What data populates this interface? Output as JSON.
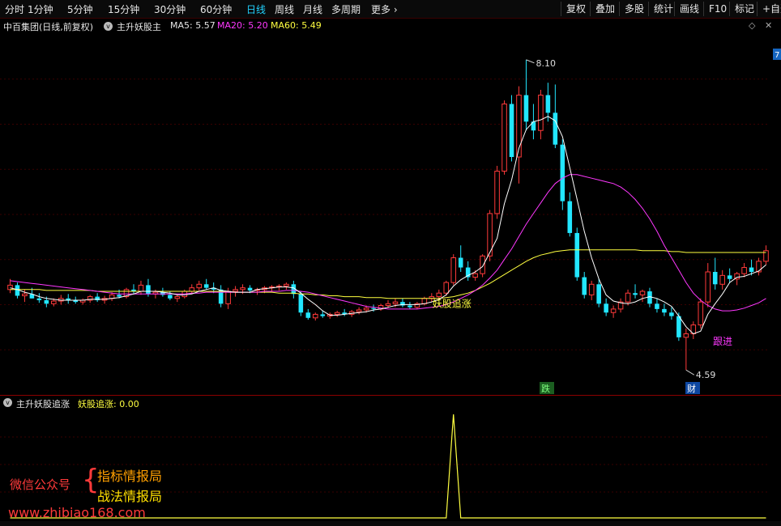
{
  "toolbar": {
    "periods": [
      "分时",
      "1分钟",
      "5分钟",
      "15分钟",
      "30分钟",
      "60分钟",
      "日线",
      "周线",
      "月线",
      "多周期",
      "更多"
    ],
    "active_period": "日线",
    "buttons": [
      "复权",
      "叠加",
      "多股",
      "统计",
      "画线",
      "F10",
      "标记",
      "+自选"
    ]
  },
  "info": {
    "stock": "中百集团(日线,前复权)",
    "indicator": "主升妖股主",
    "ma5": "MA5: 5.57",
    "ma20": "MA20: 5.20",
    "ma60": "MA60: 5.49"
  },
  "chart": {
    "price_high_label": "8.10",
    "price_low_label": "4.59",
    "signal_label": "妖股追涨",
    "marker_fall": "跌",
    "marker_cai": "财",
    "marker_follow": "跟进",
    "right_edge_label": "7"
  },
  "sub": {
    "indicator": "主升妖股追涨",
    "value": "妖股追涨: 0.00"
  },
  "watermark": {
    "wechat": "微信公众号",
    "line1": "指标情报局",
    "line2": "战法情报局",
    "url": "www.zhibiao168.com"
  },
  "colors": {
    "up": "#ff3a3a",
    "down": "#22e6ff",
    "ma5": "#ffffff",
    "ma20": "#ff38ff",
    "ma60": "#ffff40",
    "active_tab": "#22d3ff"
  },
  "chart_data": {
    "type": "candlestick",
    "ohlc": [
      [
        5.5,
        5.62,
        5.46,
        5.55
      ],
      [
        5.55,
        5.58,
        5.4,
        5.43
      ],
      [
        5.43,
        5.5,
        5.36,
        5.45
      ],
      [
        5.45,
        5.52,
        5.4,
        5.4
      ],
      [
        5.4,
        5.46,
        5.35,
        5.38
      ],
      [
        5.38,
        5.42,
        5.3,
        5.34
      ],
      [
        5.34,
        5.4,
        5.31,
        5.37
      ],
      [
        5.37,
        5.44,
        5.33,
        5.4
      ],
      [
        5.4,
        5.45,
        5.34,
        5.38
      ],
      [
        5.38,
        5.42,
        5.34,
        5.36
      ],
      [
        5.36,
        5.4,
        5.33,
        5.38
      ],
      [
        5.38,
        5.44,
        5.35,
        5.42
      ],
      [
        5.42,
        5.46,
        5.36,
        5.38
      ],
      [
        5.38,
        5.43,
        5.34,
        5.4
      ],
      [
        5.4,
        5.47,
        5.37,
        5.44
      ],
      [
        5.44,
        5.5,
        5.4,
        5.42
      ],
      [
        5.42,
        5.52,
        5.4,
        5.5
      ],
      [
        5.5,
        5.56,
        5.45,
        5.48
      ],
      [
        5.48,
        5.6,
        5.44,
        5.55
      ],
      [
        5.55,
        5.62,
        5.42,
        5.45
      ],
      [
        5.45,
        5.5,
        5.4,
        5.47
      ],
      [
        5.47,
        5.52,
        5.42,
        5.44
      ],
      [
        5.44,
        5.48,
        5.38,
        5.4
      ],
      [
        5.4,
        5.44,
        5.36,
        5.42
      ],
      [
        5.42,
        5.5,
        5.4,
        5.48
      ],
      [
        5.48,
        5.56,
        5.45,
        5.52
      ],
      [
        5.52,
        5.6,
        5.48,
        5.56
      ],
      [
        5.56,
        5.62,
        5.5,
        5.52
      ],
      [
        5.52,
        5.58,
        5.46,
        5.5
      ],
      [
        5.5,
        5.55,
        5.3,
        5.34
      ],
      [
        5.34,
        5.52,
        5.28,
        5.48
      ],
      [
        5.48,
        5.54,
        5.42,
        5.5
      ],
      [
        5.5,
        5.56,
        5.45,
        5.52
      ],
      [
        5.52,
        5.55,
        5.46,
        5.49
      ],
      [
        5.49,
        5.52,
        5.44,
        5.5
      ],
      [
        5.5,
        5.54,
        5.46,
        5.52
      ],
      [
        5.52,
        5.55,
        5.48,
        5.53
      ],
      [
        5.53,
        5.56,
        5.49,
        5.54
      ],
      [
        5.54,
        5.58,
        5.5,
        5.56
      ],
      [
        5.56,
        5.6,
        5.4,
        5.45
      ],
      [
        5.45,
        5.48,
        5.2,
        5.24
      ],
      [
        5.24,
        5.28,
        5.16,
        5.18
      ],
      [
        5.18,
        5.24,
        5.15,
        5.22
      ],
      [
        5.22,
        5.26,
        5.18,
        5.2
      ],
      [
        5.2,
        5.24,
        5.17,
        5.22
      ],
      [
        5.22,
        5.26,
        5.19,
        5.24
      ],
      [
        5.24,
        5.28,
        5.2,
        5.22
      ],
      [
        5.22,
        5.27,
        5.19,
        5.25
      ],
      [
        5.25,
        5.3,
        5.22,
        5.27
      ],
      [
        5.27,
        5.32,
        5.24,
        5.29
      ],
      [
        5.29,
        5.33,
        5.25,
        5.28
      ],
      [
        5.28,
        5.34,
        5.26,
        5.32
      ],
      [
        5.32,
        5.38,
        5.29,
        5.34
      ],
      [
        5.34,
        5.4,
        5.3,
        5.36
      ],
      [
        5.36,
        5.4,
        5.3,
        5.32
      ],
      [
        5.32,
        5.36,
        5.28,
        5.3
      ],
      [
        5.3,
        5.36,
        5.28,
        5.34
      ],
      [
        5.34,
        5.42,
        5.32,
        5.4
      ],
      [
        5.4,
        5.46,
        5.36,
        5.42
      ],
      [
        5.42,
        5.5,
        5.38,
        5.46
      ],
      [
        5.46,
        5.6,
        5.43,
        5.58
      ],
      [
        5.58,
        5.9,
        5.55,
        5.86
      ],
      [
        5.86,
        6.0,
        5.7,
        5.75
      ],
      [
        5.75,
        5.82,
        5.6,
        5.64
      ],
      [
        5.64,
        5.72,
        5.6,
        5.68
      ],
      [
        5.68,
        5.9,
        5.64,
        5.88
      ],
      [
        5.88,
        6.4,
        5.82,
        6.36
      ],
      [
        6.36,
        6.9,
        6.3,
        6.84
      ],
      [
        6.84,
        7.64,
        6.8,
        7.6
      ],
      [
        7.6,
        7.7,
        6.95,
        7.0
      ],
      [
        7.0,
        7.8,
        6.7,
        7.7
      ],
      [
        7.7,
        8.1,
        7.3,
        7.4
      ],
      [
        7.4,
        7.6,
        7.2,
        7.3
      ],
      [
        7.3,
        7.76,
        7.2,
        7.7
      ],
      [
        7.7,
        7.84,
        7.4,
        7.5
      ],
      [
        7.5,
        7.82,
        7.1,
        7.14
      ],
      [
        7.14,
        7.2,
        6.4,
        6.5
      ],
      [
        6.5,
        6.6,
        6.1,
        6.14
      ],
      [
        6.14,
        6.2,
        5.6,
        5.64
      ],
      [
        5.64,
        5.7,
        5.4,
        5.44
      ],
      [
        5.44,
        5.6,
        5.38,
        5.56
      ],
      [
        5.56,
        5.62,
        5.3,
        5.34
      ],
      [
        5.34,
        5.4,
        5.2,
        5.24
      ],
      [
        5.24,
        5.32,
        5.18,
        5.28
      ],
      [
        5.28,
        5.4,
        5.24,
        5.36
      ],
      [
        5.36,
        5.5,
        5.32,
        5.46
      ],
      [
        5.46,
        5.56,
        5.4,
        5.44
      ],
      [
        5.44,
        5.5,
        5.36,
        5.48
      ],
      [
        5.48,
        5.52,
        5.3,
        5.34
      ],
      [
        5.34,
        5.4,
        5.24,
        5.28
      ],
      [
        5.28,
        5.34,
        5.2,
        5.24
      ],
      [
        5.24,
        5.3,
        5.16,
        5.2
      ],
      [
        5.2,
        5.24,
        4.92,
        4.96
      ],
      [
        4.96,
        5.06,
        4.59,
        5.0
      ],
      [
        5.0,
        5.14,
        4.94,
        5.1
      ],
      [
        5.1,
        5.4,
        5.06,
        5.36
      ],
      [
        5.36,
        5.8,
        5.3,
        5.7
      ],
      [
        5.7,
        5.86,
        5.5,
        5.56
      ],
      [
        5.56,
        5.72,
        5.5,
        5.66
      ],
      [
        5.66,
        5.74,
        5.58,
        5.62
      ],
      [
        5.62,
        5.7,
        5.55,
        5.68
      ],
      [
        5.68,
        5.8,
        5.64,
        5.75
      ],
      [
        5.75,
        5.84,
        5.66,
        5.7
      ],
      [
        5.7,
        5.86,
        5.66,
        5.82
      ],
      [
        5.82,
        6.0,
        5.78,
        5.94
      ]
    ],
    "ma5": [
      5.52,
      5.5,
      5.47,
      5.45,
      5.42,
      5.4,
      5.39,
      5.38,
      5.38,
      5.38,
      5.38,
      5.39,
      5.39,
      5.39,
      5.4,
      5.41,
      5.43,
      5.45,
      5.48,
      5.48,
      5.48,
      5.47,
      5.46,
      5.44,
      5.44,
      5.45,
      5.48,
      5.5,
      5.52,
      5.49,
      5.48,
      5.47,
      5.47,
      5.47,
      5.5,
      5.51,
      5.52,
      5.53,
      5.53,
      5.52,
      5.46,
      5.39,
      5.33,
      5.26,
      5.21,
      5.21,
      5.22,
      5.23,
      5.24,
      5.25,
      5.27,
      5.28,
      5.3,
      5.32,
      5.33,
      5.33,
      5.33,
      5.34,
      5.36,
      5.39,
      5.44,
      5.54,
      5.61,
      5.66,
      5.7,
      5.76,
      5.92,
      6.08,
      6.47,
      6.74,
      7.1,
      7.31,
      7.4,
      7.42,
      7.46,
      7.41,
      7.23,
      6.88,
      6.52,
      6.16,
      5.86,
      5.62,
      5.44,
      5.37,
      5.35,
      5.34,
      5.36,
      5.4,
      5.42,
      5.4,
      5.36,
      5.31,
      5.2,
      5.08,
      5.0,
      5.03,
      5.22,
      5.34,
      5.45,
      5.58,
      5.64,
      5.65,
      5.68,
      5.71,
      5.78
    ],
    "ma20": [
      5.6,
      5.59,
      5.58,
      5.57,
      5.56,
      5.55,
      5.54,
      5.53,
      5.52,
      5.51,
      5.5,
      5.49,
      5.48,
      5.47,
      5.46,
      5.45,
      5.45,
      5.45,
      5.45,
      5.45,
      5.45,
      5.45,
      5.45,
      5.45,
      5.45,
      5.46,
      5.46,
      5.47,
      5.47,
      5.47,
      5.47,
      5.47,
      5.47,
      5.47,
      5.47,
      5.48,
      5.48,
      5.48,
      5.49,
      5.49,
      5.48,
      5.47,
      5.45,
      5.43,
      5.41,
      5.39,
      5.37,
      5.35,
      5.33,
      5.31,
      5.3,
      5.29,
      5.28,
      5.28,
      5.28,
      5.28,
      5.28,
      5.29,
      5.3,
      5.31,
      5.33,
      5.36,
      5.4,
      5.44,
      5.49,
      5.55,
      5.63,
      5.72,
      5.84,
      5.96,
      6.1,
      6.24,
      6.36,
      6.48,
      6.6,
      6.7,
      6.76,
      6.8,
      6.8,
      6.78,
      6.76,
      6.74,
      6.72,
      6.7,
      6.66,
      6.6,
      6.52,
      6.42,
      6.3,
      6.16,
      6.0,
      5.86,
      5.72,
      5.58,
      5.46,
      5.38,
      5.32,
      5.28,
      5.26,
      5.26,
      5.27,
      5.29,
      5.32,
      5.35,
      5.4
    ],
    "ma60": [
      5.5,
      5.5,
      5.5,
      5.5,
      5.5,
      5.49,
      5.49,
      5.49,
      5.49,
      5.49,
      5.49,
      5.49,
      5.48,
      5.48,
      5.48,
      5.48,
      5.48,
      5.48,
      5.48,
      5.48,
      5.48,
      5.48,
      5.48,
      5.48,
      5.48,
      5.48,
      5.48,
      5.48,
      5.48,
      5.48,
      5.47,
      5.47,
      5.47,
      5.47,
      5.47,
      5.47,
      5.47,
      5.46,
      5.46,
      5.46,
      5.45,
      5.45,
      5.44,
      5.44,
      5.43,
      5.43,
      5.42,
      5.42,
      5.42,
      5.41,
      5.41,
      5.41,
      5.4,
      5.4,
      5.4,
      5.4,
      5.4,
      5.4,
      5.4,
      5.4,
      5.41,
      5.42,
      5.44,
      5.46,
      5.49,
      5.53,
      5.57,
      5.62,
      5.67,
      5.72,
      5.77,
      5.82,
      5.86,
      5.89,
      5.91,
      5.93,
      5.94,
      5.95,
      5.95,
      5.95,
      5.95,
      5.95,
      5.95,
      5.95,
      5.95,
      5.95,
      5.95,
      5.94,
      5.94,
      5.94,
      5.94,
      5.93,
      5.93,
      5.92,
      5.92,
      5.92,
      5.92,
      5.92,
      5.92,
      5.92,
      5.92,
      5.92,
      5.92,
      5.92,
      5.92
    ],
    "signal_spike_index": 61,
    "sub_values_range": [
      0,
      1
    ]
  }
}
